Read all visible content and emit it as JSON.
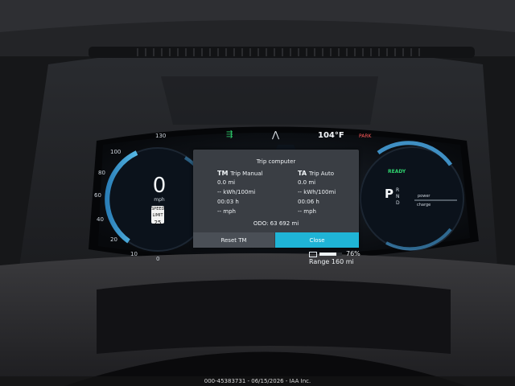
{
  "cluster": {
    "speed": {
      "value": "0",
      "unit": "mph",
      "ticks": [
        "130",
        "100",
        "80",
        "60",
        "40",
        "20",
        "10",
        "0"
      ],
      "limit_sign": {
        "top": "SPEED LIMIT",
        "value": "25"
      }
    },
    "top_bar": {
      "outside_temp": "104°F",
      "park_indicator": "PARK"
    },
    "trip_computer": {
      "title": "Trip computer",
      "trip_manual": {
        "code": "TM",
        "label": "Trip Manual",
        "distance": "0.0 mi",
        "consumption": "-- kWh/100mi",
        "time": "00:03 h",
        "speed": "-- mph"
      },
      "trip_auto": {
        "code": "TA",
        "label": "Trip Auto",
        "distance": "0.0 mi",
        "consumption": "-- kWh/100mi",
        "time": "00:06 h",
        "speed": "-- mph"
      },
      "odometer": "ODO: 63 692 mi",
      "reset_label": "Reset TM",
      "close_label": "Close"
    },
    "power_gauge": {
      "ready": "READY",
      "gear_selected": "P",
      "gear_others": [
        "R",
        "N",
        "D"
      ],
      "power_label": "power",
      "charge_label": "charge"
    },
    "battery": {
      "percent_text": "76%",
      "level": 0.76,
      "range_text": "Range 160 mi"
    }
  },
  "watermark": {
    "text": "000-45383731 - 06/15/2026 - IAA Inc."
  },
  "colors": {
    "accent_blue": "#1fb4d6",
    "ready_green": "#2fd36f",
    "park_red": "#ff5a5a",
    "popup_bg": "#3a3e44"
  },
  "icons": {
    "lane_assist": "lane-assist-icon",
    "road": "road-icon"
  }
}
